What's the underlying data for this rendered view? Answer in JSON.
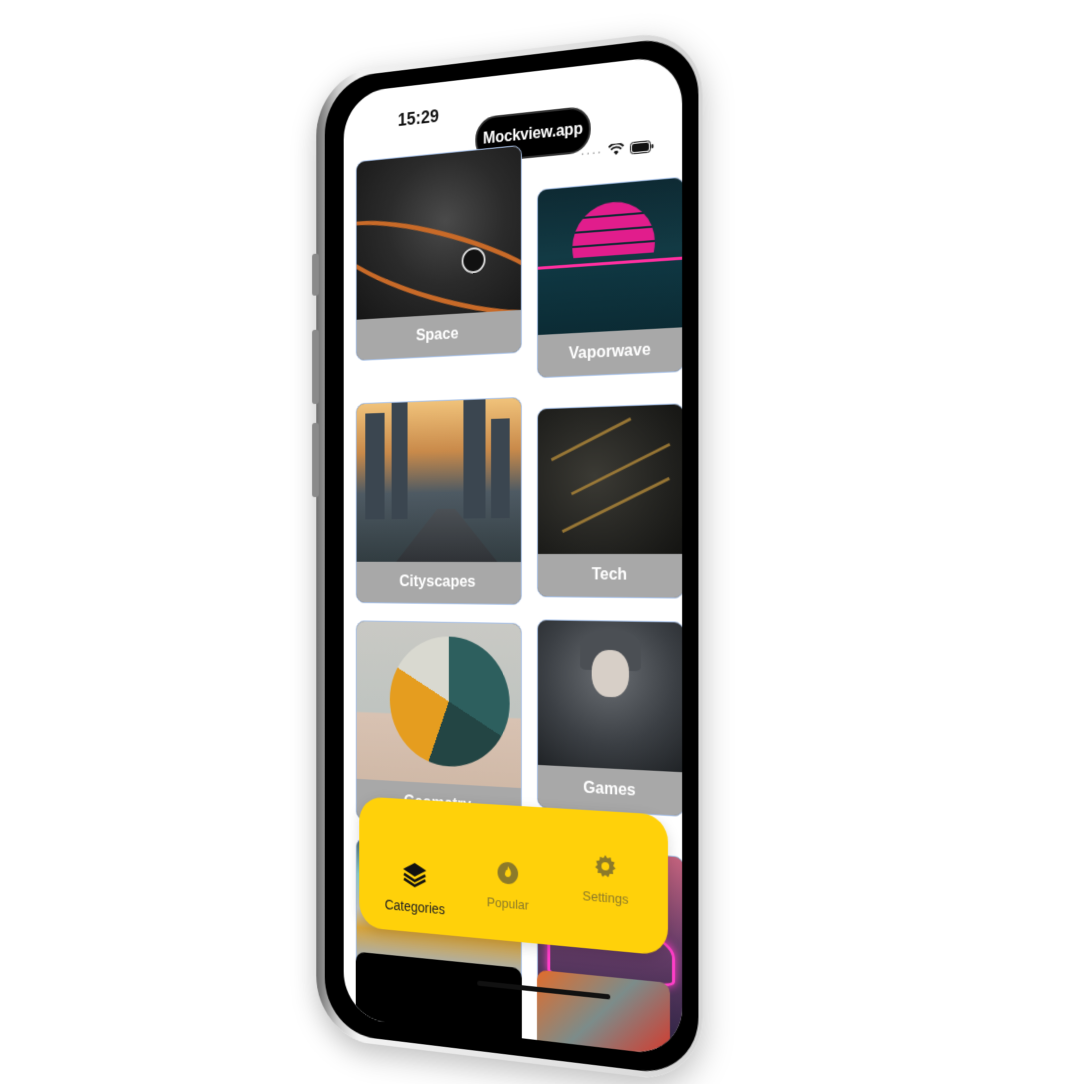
{
  "status_bar": {
    "time": "15:29",
    "dynamic_island_text": "Mockview.app",
    "icons": [
      "dots-icon",
      "wifi-icon",
      "battery-icon"
    ]
  },
  "categories": [
    {
      "label": "Space"
    },
    {
      "label": "Vaporwave"
    },
    {
      "label": "Cityscapes"
    },
    {
      "label": "Tech"
    },
    {
      "label": "Geometry"
    },
    {
      "label": "Games"
    },
    {
      "label": ""
    },
    {
      "label": ""
    }
  ],
  "tab_bar": {
    "background": "#FFD10A",
    "tabs": [
      {
        "label": "Categories",
        "icon": "layers-icon",
        "active": true
      },
      {
        "label": "Popular",
        "icon": "fire-icon",
        "active": false
      },
      {
        "label": "Settings",
        "icon": "gear-icon",
        "active": false
      }
    ]
  },
  "colors": {
    "label_bar": "#A8A8A8",
    "card_border": "#A9C2E8"
  }
}
